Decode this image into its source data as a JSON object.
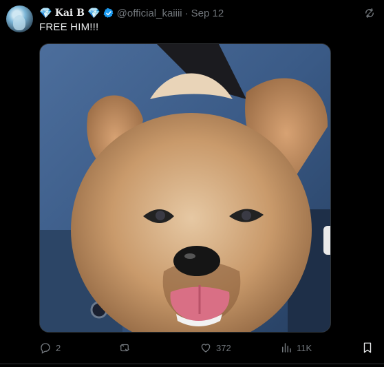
{
  "tweet": {
    "name_prefix_emoji": "💎",
    "name": "Kai B",
    "name_suffix_emoji": "💎",
    "handle": "@official_kaiiii",
    "separator": "·",
    "date": "Sep 12",
    "text": "FREE HIM!!!"
  },
  "media": {
    "subject": "yorkshire-terrier-puppy",
    "icons": {}
  },
  "actions": {
    "replies": "2",
    "retweets": "",
    "likes": "372",
    "views": "11K"
  },
  "icons": {
    "verified": "verified-badge-icon",
    "sync": "sync-icon",
    "reply": "reply-icon",
    "retweet": "retweet-icon",
    "like": "heart-icon",
    "views": "views-chart-icon",
    "bookmark": "bookmark-icon"
  },
  "colors": {
    "background": "#000000",
    "text": "#e7e9ea",
    "muted": "#71767b",
    "verified": "#1d9bf0",
    "diamond": "#4fb3ff"
  }
}
